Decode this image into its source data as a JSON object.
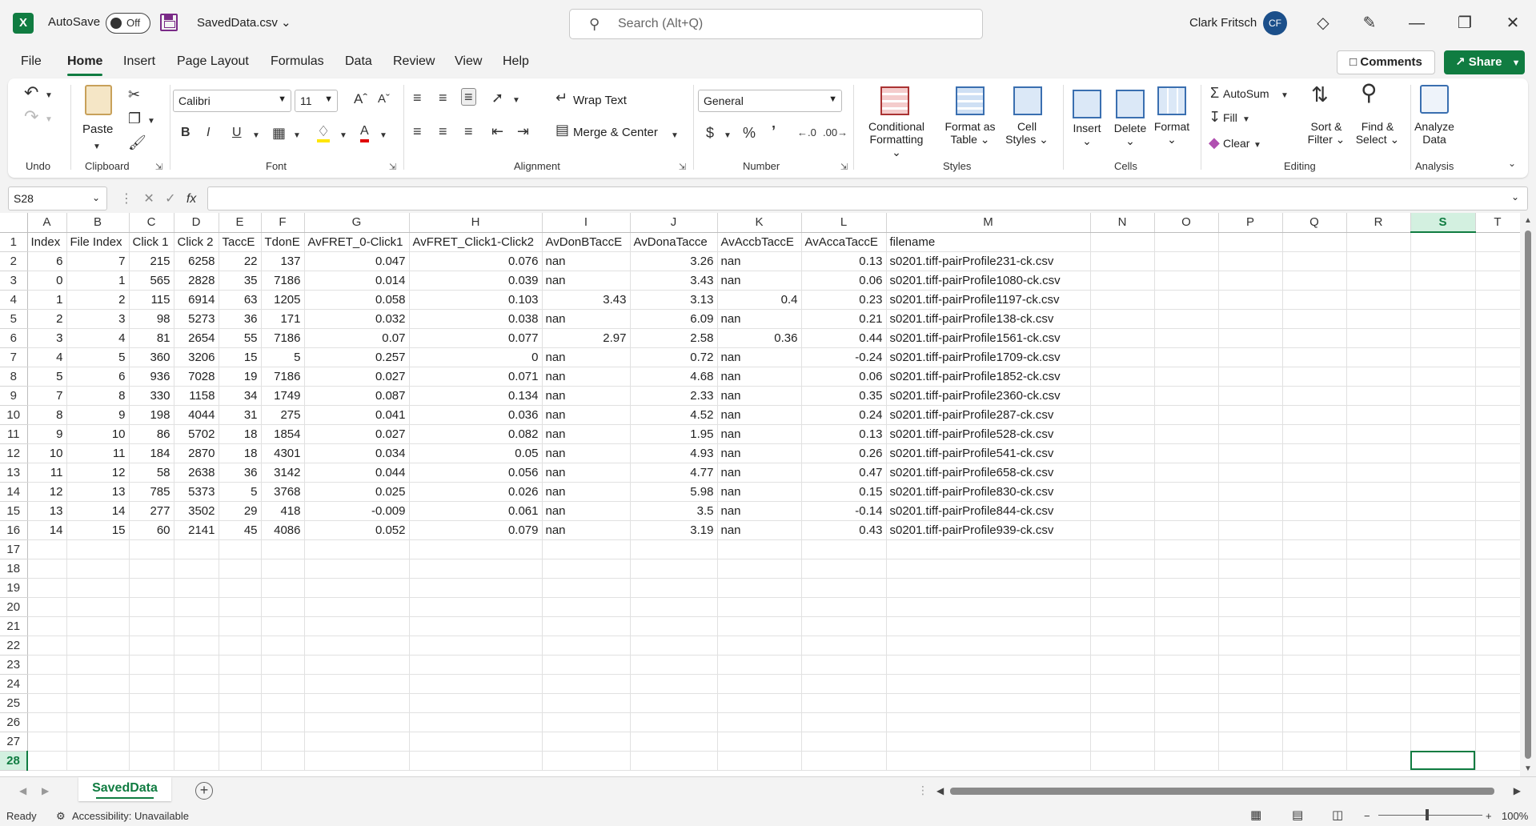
{
  "titlebar": {
    "app_logo": "X",
    "autosave_label": "AutoSave",
    "autosave_state": "Off",
    "file_name": "SavedData.csv",
    "search_placeholder": "Search (Alt+Q)",
    "user_name": "Clark Fritsch",
    "user_initials": "CF"
  },
  "menu": {
    "tabs": [
      "File",
      "Home",
      "Insert",
      "Page Layout",
      "Formulas",
      "Data",
      "Review",
      "View",
      "Help"
    ],
    "active": "Home",
    "comments": "Comments",
    "share": "Share"
  },
  "ribbon": {
    "undo_label": "Undo",
    "paste": "Paste",
    "clipboard": "Clipboard",
    "font_name": "Calibri",
    "font_size": "11",
    "font": "Font",
    "wrap_text": "Wrap Text",
    "merge_center": "Merge & Center",
    "alignment": "Alignment",
    "number_format": "General",
    "number": "Number",
    "conditional_formatting": [
      "Conditional",
      "Formatting"
    ],
    "format_as_table": [
      "Format as",
      "Table"
    ],
    "cell_styles": [
      "Cell",
      "Styles"
    ],
    "styles": "Styles",
    "insert": "Insert",
    "delete": "Delete",
    "format": "Format",
    "cells": "Cells",
    "autosum": "AutoSum",
    "fill": "Fill",
    "clear": "Clear",
    "sort_filter": [
      "Sort &",
      "Filter"
    ],
    "find_select": [
      "Find &",
      "Select"
    ],
    "editing": "Editing",
    "analyze_data": [
      "Analyze",
      "Data"
    ],
    "analysis": "Analysis"
  },
  "formula_bar": {
    "name_box": "S28",
    "fx": "fx",
    "value": ""
  },
  "grid": {
    "columns": [
      "A",
      "B",
      "C",
      "D",
      "E",
      "F",
      "G",
      "H",
      "I",
      "J",
      "K",
      "L",
      "M",
      "N",
      "O",
      "P",
      "Q",
      "R",
      "S",
      "T"
    ],
    "selected_column": "S",
    "selected_row": 28,
    "row_count": 28,
    "header": [
      "Index",
      "File Index",
      "Click 1",
      "Click 2",
      "TaccE",
      "TdonE",
      "AvFRET_0-Click1",
      "AvFRET_Click1-Click2",
      "AvDonBTaccE",
      "AvDonaTacce",
      "AvAccbTaccE",
      "AvAccaTaccE",
      "filename"
    ],
    "rows": [
      [
        "6",
        "7",
        "215",
        "6258",
        "22",
        "137",
        "0.047",
        "0.076",
        "nan",
        "3.26",
        "nan",
        "0.13",
        "s0201.tiff-pairProfile231-ck.csv"
      ],
      [
        "0",
        "1",
        "565",
        "2828",
        "35",
        "7186",
        "0.014",
        "0.039",
        "nan",
        "3.43",
        "nan",
        "0.06",
        "s0201.tiff-pairProfile1080-ck.csv"
      ],
      [
        "1",
        "2",
        "115",
        "6914",
        "63",
        "1205",
        "0.058",
        "0.103",
        "3.43",
        "3.13",
        "0.4",
        "0.23",
        "s0201.tiff-pairProfile1197-ck.csv"
      ],
      [
        "2",
        "3",
        "98",
        "5273",
        "36",
        "171",
        "0.032",
        "0.038",
        "nan",
        "6.09",
        "nan",
        "0.21",
        "s0201.tiff-pairProfile138-ck.csv"
      ],
      [
        "3",
        "4",
        "81",
        "2654",
        "55",
        "7186",
        "0.07",
        "0.077",
        "2.97",
        "2.58",
        "0.36",
        "0.44",
        "s0201.tiff-pairProfile1561-ck.csv"
      ],
      [
        "4",
        "5",
        "360",
        "3206",
        "15",
        "5",
        "0.257",
        "0",
        "nan",
        "0.72",
        "nan",
        "-0.24",
        "s0201.tiff-pairProfile1709-ck.csv"
      ],
      [
        "5",
        "6",
        "936",
        "7028",
        "19",
        "7186",
        "0.027",
        "0.071",
        "nan",
        "4.68",
        "nan",
        "0.06",
        "s0201.tiff-pairProfile1852-ck.csv"
      ],
      [
        "7",
        "8",
        "330",
        "1158",
        "34",
        "1749",
        "0.087",
        "0.134",
        "nan",
        "2.33",
        "nan",
        "0.35",
        "s0201.tiff-pairProfile2360-ck.csv"
      ],
      [
        "8",
        "9",
        "198",
        "4044",
        "31",
        "275",
        "0.041",
        "0.036",
        "nan",
        "4.52",
        "nan",
        "0.24",
        "s0201.tiff-pairProfile287-ck.csv"
      ],
      [
        "9",
        "10",
        "86",
        "5702",
        "18",
        "1854",
        "0.027",
        "0.082",
        "nan",
        "1.95",
        "nan",
        "0.13",
        "s0201.tiff-pairProfile528-ck.csv"
      ],
      [
        "10",
        "11",
        "184",
        "2870",
        "18",
        "4301",
        "0.034",
        "0.05",
        "nan",
        "4.93",
        "nan",
        "0.26",
        "s0201.tiff-pairProfile541-ck.csv"
      ],
      [
        "11",
        "12",
        "58",
        "2638",
        "36",
        "3142",
        "0.044",
        "0.056",
        "nan",
        "4.77",
        "nan",
        "0.47",
        "s0201.tiff-pairProfile658-ck.csv"
      ],
      [
        "12",
        "13",
        "785",
        "5373",
        "5",
        "3768",
        "0.025",
        "0.026",
        "nan",
        "5.98",
        "nan",
        "0.15",
        "s0201.tiff-pairProfile830-ck.csv"
      ],
      [
        "13",
        "14",
        "277",
        "3502",
        "29",
        "418",
        "-0.009",
        "0.061",
        "nan",
        "3.5",
        "nan",
        "-0.14",
        "s0201.tiff-pairProfile844-ck.csv"
      ],
      [
        "14",
        "15",
        "60",
        "2141",
        "45",
        "4086",
        "0.052",
        "0.079",
        "nan",
        "3.19",
        "nan",
        "0.43",
        "s0201.tiff-pairProfile939-ck.csv"
      ]
    ]
  },
  "sheets": {
    "active": "SavedData"
  },
  "status": {
    "ready": "Ready",
    "accessibility": "Accessibility: Unavailable",
    "zoom": "100%"
  },
  "colors": {
    "accent": "#107c41"
  }
}
